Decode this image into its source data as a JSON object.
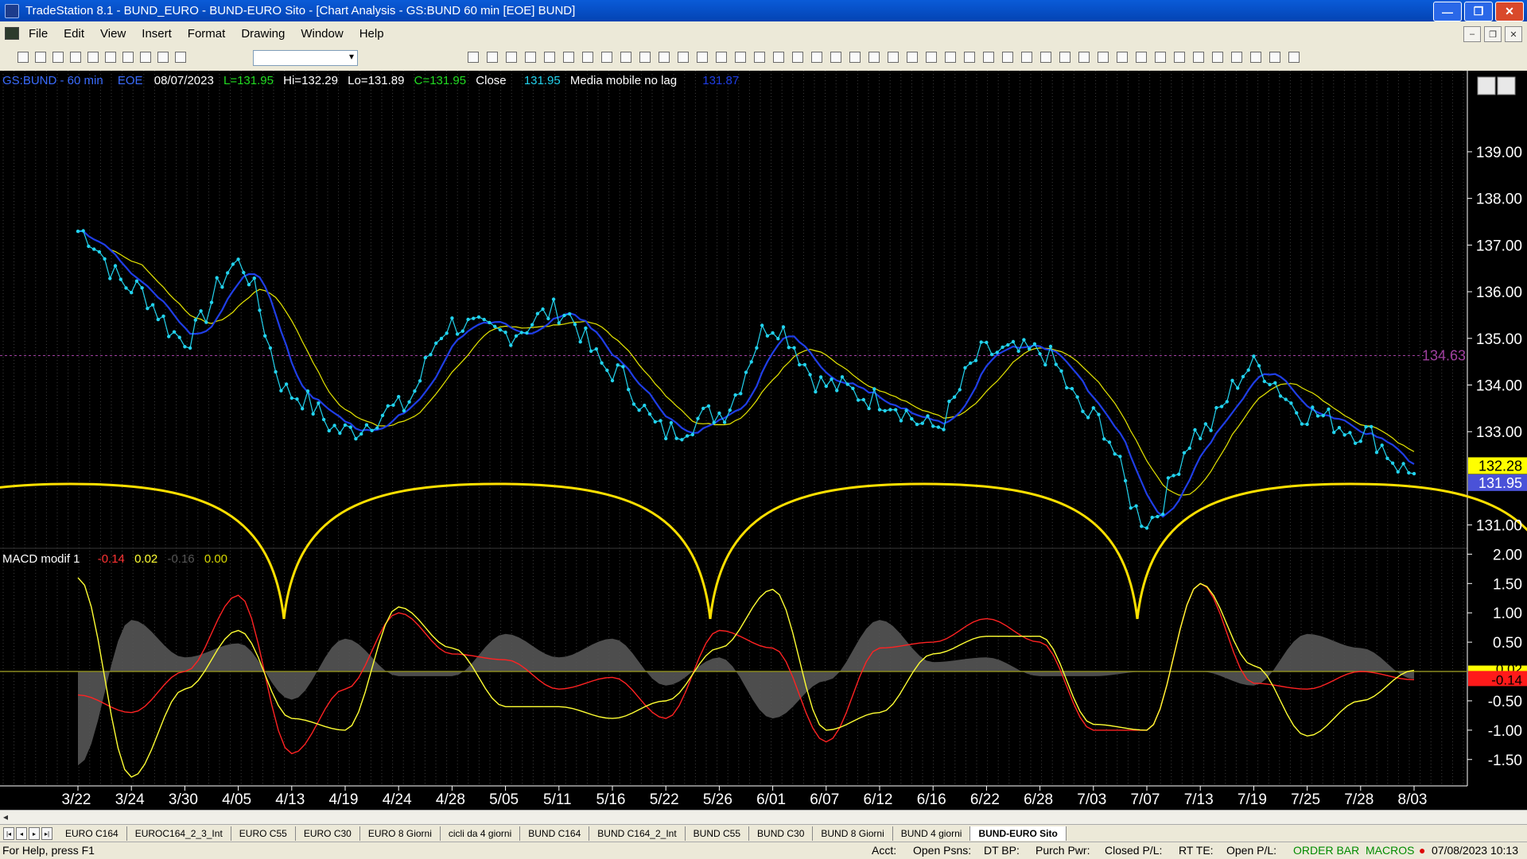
{
  "window": {
    "title": "TradeStation 8.1 - BUND_EURO - BUND-EURO Sito - [Chart Analysis - GS:BUND  60 min  [EOE] BUND]"
  },
  "menu": [
    "File",
    "Edit",
    "View",
    "Insert",
    "Format",
    "Drawing",
    "Window",
    "Help"
  ],
  "colors": {
    "price": "#22d3ee",
    "avg_blue": "#1f3ee6",
    "avg_yellow": "#e6e600",
    "cycles": "#ffe000",
    "macd_red": "#ff2222",
    "macd_yellow": "#ffff33",
    "hist": "#555555",
    "ref_line": "#a040a0"
  },
  "price_panel": {
    "info": {
      "symbol": "GS:BUND - 60 min",
      "session": "EOE",
      "date": "08/07/2023",
      "low": "L=131.95",
      "high": "Hi=132.29",
      "lo": "Lo=131.89",
      "close": "C=131.95",
      "close_label": "Close",
      "close_value": "131.95",
      "ma_label": "Media mobile no lag",
      "ma_value": "131.87"
    },
    "y_ticks": [
      "139.00",
      "138.00",
      "137.00",
      "136.00",
      "135.00",
      "134.00",
      "133.00",
      "131.00"
    ],
    "ref_line_label": "134.63",
    "price_tag_yellow": "132.28",
    "price_tag_blue": "131.95"
  },
  "macd_panel": {
    "name": "MACD modif 1",
    "v1": "-0.14",
    "v2": "0.02",
    "v3": "-0.16",
    "v4": "0.00",
    "y_ticks": [
      "2.00",
      "1.50",
      "1.00",
      "0.50",
      "-0.50",
      "-1.00",
      "-1.50"
    ],
    "tag_yellow": "0.02",
    "tag_red": "-0.14"
  },
  "x_labels": [
    "3/22",
    "3/24",
    "3/30",
    "4/05",
    "4/13",
    "4/19",
    "4/24",
    "4/28",
    "5/05",
    "5/11",
    "5/16",
    "5/22",
    "5/26",
    "6/01",
    "6/07",
    "6/12",
    "6/16",
    "6/22",
    "6/28",
    "7/03",
    "7/07",
    "7/13",
    "7/19",
    "7/25",
    "7/28",
    "8/03"
  ],
  "tabs": [
    "EURO C164",
    "EUROC164_2_3_Int",
    "EURO C55",
    "EURO C30",
    "EURO 8 Giorni",
    "cicli da 4 giorni",
    "BUND C164",
    "BUND C164_2_Int",
    "BUND C55",
    "BUND  C30",
    "BUND 8 Giorni",
    "BUND 4 giorni",
    "BUND-EURO Sito"
  ],
  "status": {
    "help": "For Help, press F1",
    "acct": "Acct:",
    "open_psns": "Open Psns:",
    "dt_bp": "DT BP:",
    "purch_pwr": "Purch Pwr:",
    "closed_pl": "Closed P/L:",
    "rt_te": "RT TE:",
    "open_pl": "Open P/L:",
    "order_bar": "ORDER BAR",
    "macros": "MACROS",
    "datetime": "07/08/2023 10:13"
  },
  "chart_data": [
    {
      "type": "line",
      "title": "GS:BUND - 60 min",
      "x": [
        "3/22",
        "3/24",
        "3/30",
        "4/05",
        "4/13",
        "4/19",
        "4/24",
        "4/28",
        "5/05",
        "5/11",
        "5/16",
        "5/22",
        "5/26",
        "6/01",
        "6/07",
        "6/12",
        "6/16",
        "6/22",
        "6/28",
        "7/03",
        "7/07",
        "7/13",
        "7/19",
        "7/25",
        "7/28",
        "8/03"
      ],
      "series": [
        {
          "name": "Close",
          "values": [
            137.3,
            136.1,
            135.0,
            136.6,
            133.8,
            133.0,
            133.5,
            135.3,
            135.1,
            135.6,
            134.3,
            133.0,
            133.4,
            135.3,
            134.0,
            133.7,
            133.1,
            134.7,
            134.7,
            133.3,
            131.1,
            133.0,
            134.4,
            133.4,
            133.0,
            132.1
          ]
        }
      ],
      "ylim": [
        130.5,
        139.8
      ],
      "reference_line": 134.63
    },
    {
      "type": "line",
      "title": "MACD modif 1",
      "x": [
        "3/22",
        "3/24",
        "3/30",
        "4/05",
        "4/13",
        "4/19",
        "4/24",
        "4/28",
        "5/05",
        "5/11",
        "5/16",
        "5/22",
        "5/26",
        "6/01",
        "6/07",
        "6/12",
        "6/16",
        "6/22",
        "6/28",
        "7/03",
        "7/07",
        "7/13",
        "7/19",
        "7/25",
        "7/28",
        "8/03"
      ],
      "series": [
        {
          "values": [
            -0.4,
            -0.7,
            0.0,
            1.3,
            -1.4,
            -0.3,
            1.0,
            0.3,
            0.2,
            -0.3,
            -0.1,
            -0.8,
            0.7,
            0.4,
            -1.2,
            0.4,
            0.5,
            0.9,
            0.5,
            -1.0,
            -1.0,
            1.5,
            -0.2,
            -0.3,
            0.0,
            -0.14
          ]
        },
        {
          "values": [
            1.6,
            -1.8,
            -0.3,
            0.7,
            -0.8,
            -1.0,
            1.1,
            0.4,
            -0.6,
            -0.6,
            -0.8,
            -0.5,
            0.4,
            1.4,
            -1.0,
            -0.7,
            0.3,
            0.6,
            0.6,
            -0.9,
            -1.0,
            1.5,
            0.1,
            -1.1,
            -0.5,
            0.02
          ]
        }
      ],
      "ylim": [
        -1.95,
        2.1
      ]
    }
  ]
}
